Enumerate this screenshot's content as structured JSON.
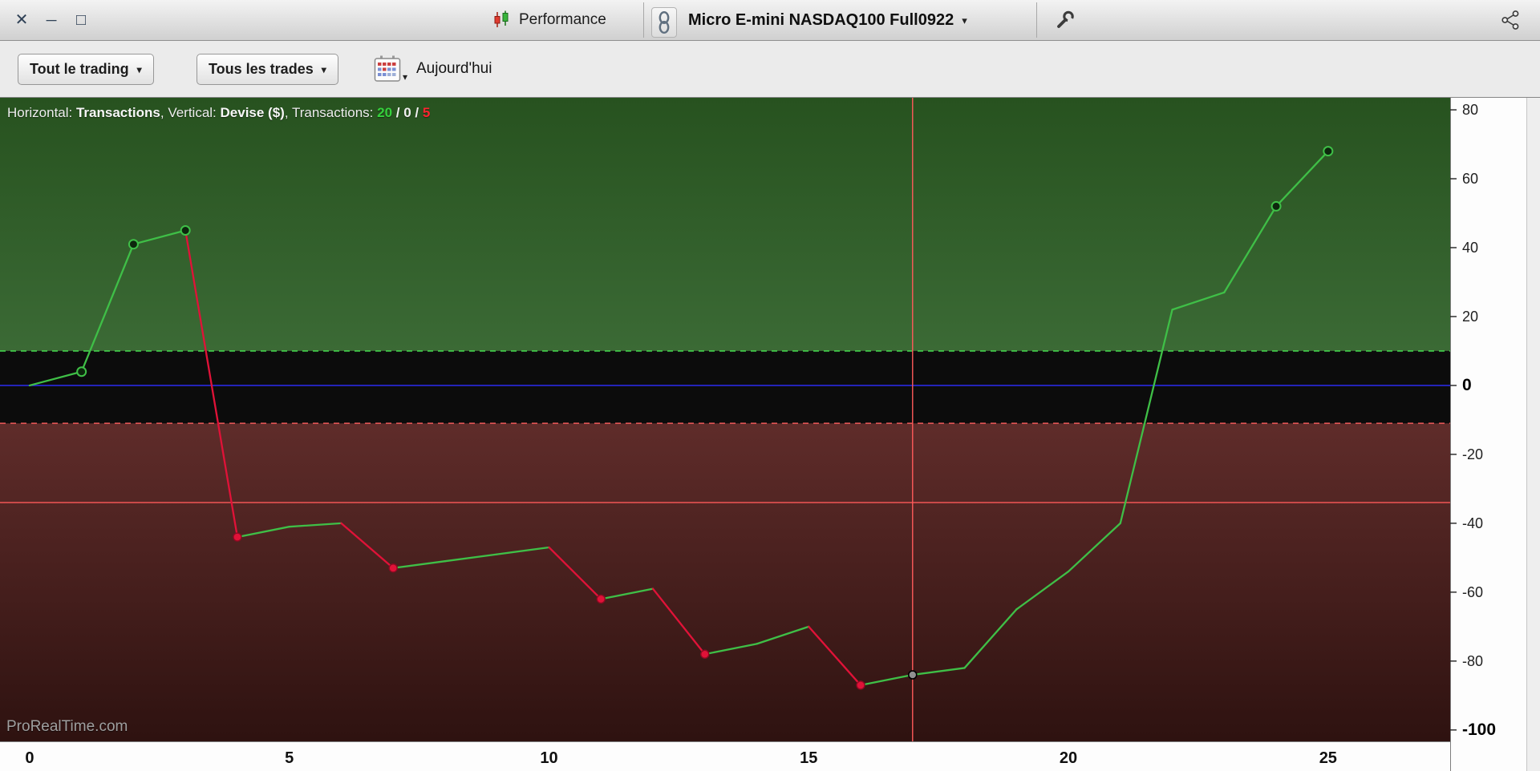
{
  "titlebar": {
    "view_label": "Performance",
    "instrument": "Micro E-mini NASDAQ100 Full0922"
  },
  "icons": {
    "close": "✕",
    "minimize": "─",
    "maximize": "□",
    "caret": "▾"
  },
  "toolbar": {
    "trading_filter": "Tout le trading",
    "trades_filter": "Tous les trades",
    "date_label": "Aujourd'hui"
  },
  "legend": {
    "horizontal_label": "Horizontal: ",
    "horizontal_value": "Transactions",
    "sep_a": ", ",
    "vertical_label": "Vertical: ",
    "vertical_value": "Devise ($)",
    "transactions_label": ", Transactions: ",
    "wins": "20",
    "sep_b": " / ",
    "breakeven": "0",
    "sep_c": " / ",
    "losses": "5"
  },
  "watermark": "ProRealTime.com",
  "chart_data": {
    "type": "line",
    "title": "Equity curve (Performance)",
    "xlabel": "Transactions",
    "ylabel": "Devise ($)",
    "x": [
      0,
      1,
      2,
      3,
      4,
      5,
      6,
      7,
      8,
      9,
      10,
      11,
      12,
      13,
      14,
      15,
      16,
      17,
      18,
      19,
      20,
      21,
      22,
      23,
      24,
      25
    ],
    "values": [
      0,
      4,
      41,
      45,
      -44,
      -41,
      -40,
      -53,
      -51,
      -49,
      -47,
      -62,
      -59,
      -78,
      -75,
      -70,
      -87,
      -84,
      -82,
      -65,
      -54,
      -40,
      22,
      27,
      52,
      68
    ],
    "x_ticks": [
      0,
      5,
      10,
      15,
      20,
      25
    ],
    "y_ticks": [
      80,
      60,
      40,
      20,
      0,
      -20,
      -40,
      -60,
      -80,
      -100
    ],
    "bold_y_ticks": [
      0,
      -100
    ],
    "xlim": [
      -0.57,
      27.35
    ],
    "ylim": [
      -103.3,
      83.5
    ],
    "grid": false,
    "zones": {
      "upper_threshold": 10,
      "lower_threshold": -11
    },
    "crosshair": {
      "x": 17,
      "y": -34
    },
    "trade_counts": {
      "wins": 20,
      "breakeven": 0,
      "losses": 5
    },
    "markers": [
      {
        "x": 1,
        "type": "win"
      },
      {
        "x": 2,
        "type": "win"
      },
      {
        "x": 3,
        "type": "win"
      },
      {
        "x": 4,
        "type": "loss"
      },
      {
        "x": 7,
        "type": "loss"
      },
      {
        "x": 11,
        "type": "loss"
      },
      {
        "x": 13,
        "type": "loss"
      },
      {
        "x": 16,
        "type": "loss"
      },
      {
        "x": 17,
        "type": "current"
      },
      {
        "x": 24,
        "type": "win"
      },
      {
        "x": 25,
        "type": "win"
      }
    ],
    "colors": {
      "win": "#3fbf47",
      "loss": "#e01238",
      "zero_line": "#2a2ae0",
      "crosshair": "#ff5a5a",
      "upper_dashed": "#42d24b",
      "lower_dashed": "#e25555",
      "zone_profit_top": "#27521f",
      "zone_profit_bottom": "#3b6a35",
      "zone_neutral": "#0c0c0c",
      "zone_loss_top": "#5f2c2a",
      "zone_loss_bottom": "#2e1210",
      "marker_win_fill": "#0d260d",
      "marker_loss_edge": "#8c0a22",
      "marker_current_fill": "#909090"
    }
  }
}
